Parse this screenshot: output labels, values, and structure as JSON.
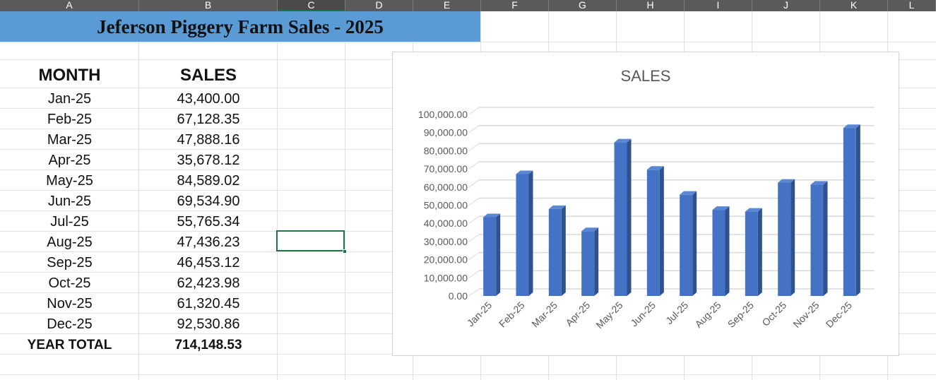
{
  "columns": [
    "A",
    "B",
    "C",
    "D",
    "E",
    "F",
    "G",
    "H",
    "I",
    "J",
    "K",
    "L"
  ],
  "sheet_title": "Jeferson Piggery Farm Sales - 2025",
  "table": {
    "month_header": "MONTH",
    "sales_header": "SALES",
    "rows": [
      {
        "month": "Jan-25",
        "sales": "43,400.00"
      },
      {
        "month": "Feb-25",
        "sales": "67,128.35"
      },
      {
        "month": "Mar-25",
        "sales": "47,888.16"
      },
      {
        "month": "Apr-25",
        "sales": "35,678.12"
      },
      {
        "month": "May-25",
        "sales": "84,589.02"
      },
      {
        "month": "Jun-25",
        "sales": "69,534.90"
      },
      {
        "month": "Jul-25",
        "sales": "55,765.34"
      },
      {
        "month": "Aug-25",
        "sales": "47,436.23"
      },
      {
        "month": "Sep-25",
        "sales": "46,453.12"
      },
      {
        "month": "Oct-25",
        "sales": "62,423.98"
      },
      {
        "month": "Nov-25",
        "sales": "61,320.45"
      },
      {
        "month": "Dec-25",
        "sales": "92,530.86"
      }
    ],
    "total_label": "YEAR TOTAL",
    "total_value": "714,148.53"
  },
  "selected_cell": "C9",
  "colors": {
    "title_fill": "#5b9bd5",
    "bar_front": "#4472c4",
    "bar_side": "#2f528f",
    "bar_top": "#5a86d6",
    "selection": "#217346"
  },
  "chart_data": {
    "type": "bar",
    "title": "SALES",
    "categories": [
      "Jan-25",
      "Feb-25",
      "Mar-25",
      "Apr-25",
      "May-25",
      "Jun-25",
      "Jul-25",
      "Aug-25",
      "Sep-25",
      "Oct-25",
      "Nov-25",
      "Dec-25"
    ],
    "series": [
      {
        "values": [
          43400.0,
          67128.35,
          47888.16,
          35678.12,
          84589.02,
          69534.9,
          55765.34,
          47436.23,
          46453.12,
          62423.98,
          61320.45,
          92530.86
        ]
      }
    ],
    "ylim": [
      0,
      100000
    ],
    "yticks": [
      "0.00",
      "10,000.00",
      "20,000.00",
      "30,000.00",
      "40,000.00",
      "50,000.00",
      "60,000.00",
      "70,000.00",
      "80,000.00",
      "90,000.00",
      "100,000.00"
    ],
    "grid": true,
    "style": "3d-column"
  }
}
